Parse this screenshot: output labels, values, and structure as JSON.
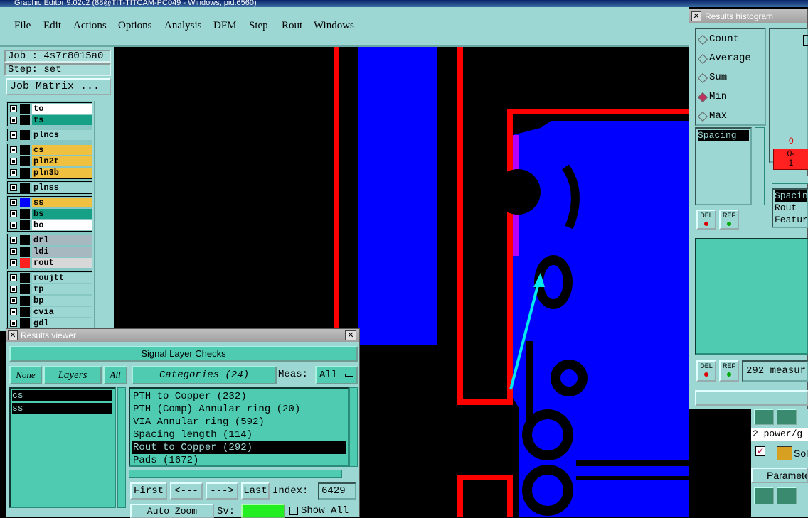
{
  "title_bar": "Graphic Editor 9.02c2 (88@TIT-TITCAM-PC049 - Windows, pid.6560)",
  "menu": [
    "File",
    "Edit",
    "Actions",
    "Options",
    "Analysis",
    "DFM",
    "Step",
    "Rout",
    "Windows"
  ],
  "job": {
    "job_label": "Job : 4s7r8015a0",
    "step_label": "Step: set",
    "matrix_button": "Job Matrix ..."
  },
  "layers": [
    {
      "name": "to",
      "color": "#ffffff"
    },
    {
      "name": "ts",
      "color": "#16a085"
    },
    {
      "name": "plncs",
      "color": "#9cd7d3"
    },
    {
      "name": "cs",
      "color": "#f0c040"
    },
    {
      "name": "pln2t",
      "color": "#f0c040"
    },
    {
      "name": "pln3b",
      "color": "#f0c040"
    },
    {
      "name": "plnss",
      "color": "#9cd7d3"
    },
    {
      "name": "ss",
      "color": "#f0c040"
    },
    {
      "name": "bs",
      "color": "#16a085"
    },
    {
      "name": "bo",
      "color": "#ffffff"
    },
    {
      "name": "drl",
      "color": "#a8b8c0"
    },
    {
      "name": "ldi",
      "color": "#a8b8c0"
    },
    {
      "name": "rout",
      "color": "#d8d8d8"
    },
    {
      "name": "roujtt",
      "color": "#9cd7d3"
    },
    {
      "name": "tp",
      "color": "#9cd7d3"
    },
    {
      "name": "bp",
      "color": "#9cd7d3"
    },
    {
      "name": "cvia",
      "color": "#9cd7d3"
    },
    {
      "name": "gdl",
      "color": "#9cd7d3"
    }
  ],
  "results_viewer": {
    "title": "Results viewer",
    "header": "Signal Layer Checks",
    "none": "None",
    "layers": "Layers",
    "all": "All",
    "categories": "Categories (24)",
    "meas_label": "Meas:",
    "meas_value": "All",
    "layer_items": [
      "cs",
      "ss"
    ],
    "category_items": [
      "PTH to Copper (232)",
      "PTH (Comp) Annular ring (20)",
      "VIA Annular ring (592)",
      "Spacing length (114)",
      "Rout to Copper (292)",
      "Pads (1672)"
    ],
    "selected_category": 4,
    "first": "First",
    "prev": "<---",
    "next": "--->",
    "last": "Last",
    "index_label": "Index:",
    "index_value": "6429",
    "auto_zoom": "Auto Zoom",
    "sv_label": "Sv:",
    "show_all": "Show All"
  },
  "histogram": {
    "title": "Results histogram",
    "options": [
      "Count",
      "Average",
      "Sum",
      "Min",
      "Max"
    ],
    "selected": 3,
    "spacing_item": "Spacing",
    "axis_zero": "0",
    "bin_label": "0-\n1",
    "del": "DEL",
    "ref": "REF",
    "detail_lines": [
      "Spacin",
      "Rout",
      "Featur"
    ],
    "measure_text": "292 measur",
    "side_text": "2 power/g",
    "side_sol": "Sol",
    "side_param": "Paramete"
  }
}
